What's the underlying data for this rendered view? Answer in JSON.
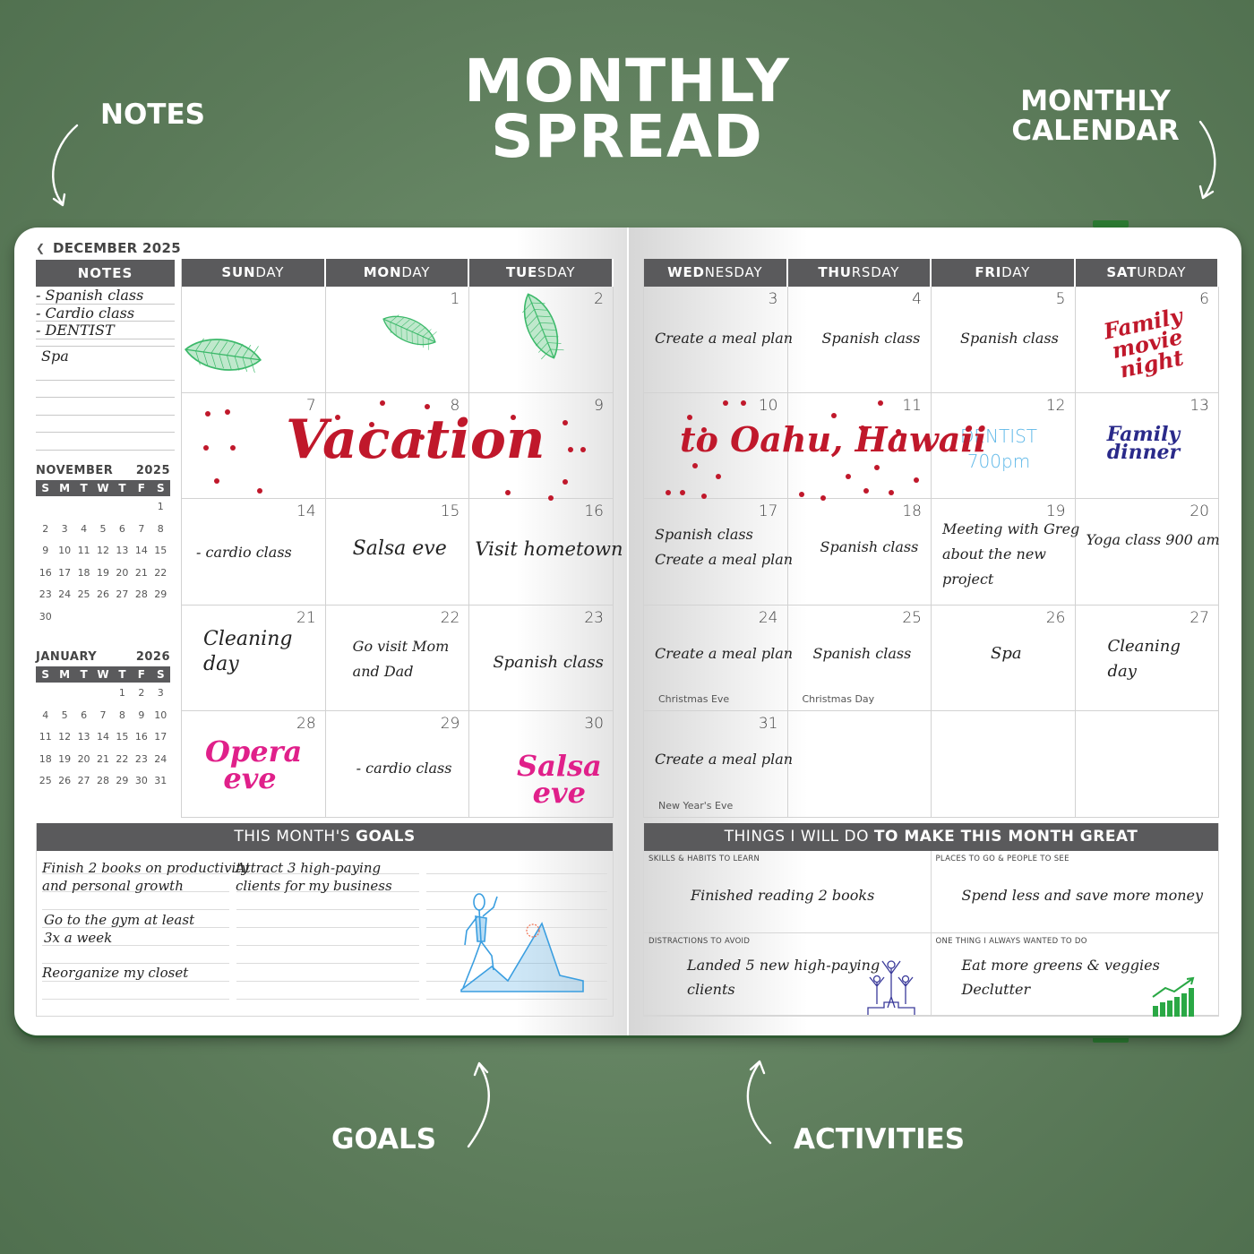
{
  "hero": {
    "title_line1": "MONTHLY",
    "title_line2": "SPREAD",
    "callouts": {
      "notes": "NOTES",
      "monthly_calendar_line1": "MONTHLY",
      "monthly_calendar_line2": "CALENDAR",
      "goals": "GOALS",
      "activities": "ACTIVITIES"
    }
  },
  "colors": {
    "background": "#6a8a68",
    "header_gray": "#5a5a5c",
    "vacation_red": "#c0182b",
    "dentist_blue": "#5fb8e8",
    "family_dinner_navy": "#2a2a8a",
    "pink": "#e0208a",
    "leaf_green": "#3cb96a"
  },
  "planner": {
    "month_title": "DECEMBER 2025",
    "notes": {
      "header": "NOTES",
      "lines": [
        "- Spanish class",
        "- Cardio class",
        "- DENTIST",
        "",
        "Spa",
        "",
        "",
        "",
        ""
      ]
    },
    "mini_calendars": [
      {
        "month": "NOVEMBER",
        "year": "2025",
        "weekdays": [
          "S",
          "M",
          "T",
          "W",
          "T",
          "F",
          "S"
        ],
        "days": [
          "",
          "",
          "",
          "",
          "",
          "",
          "1",
          "2",
          "3",
          "4",
          "5",
          "6",
          "7",
          "8",
          "9",
          "10",
          "11",
          "12",
          "13",
          "14",
          "15",
          "16",
          "17",
          "18",
          "19",
          "20",
          "21",
          "22",
          "23",
          "24",
          "25",
          "26",
          "27",
          "28",
          "29",
          "30"
        ]
      },
      {
        "month": "JANUARY",
        "year": "2026",
        "weekdays": [
          "S",
          "M",
          "T",
          "W",
          "T",
          "F",
          "S"
        ],
        "days": [
          "",
          "",
          "",
          "",
          "1",
          "2",
          "3",
          "4",
          "5",
          "6",
          "7",
          "8",
          "9",
          "10",
          "11",
          "12",
          "13",
          "14",
          "15",
          "16",
          "17",
          "18",
          "19",
          "20",
          "21",
          "22",
          "23",
          "24",
          "25",
          "26",
          "27",
          "28",
          "29",
          "30",
          "31"
        ]
      }
    ],
    "weekday_headers": [
      {
        "bold": "SUN",
        "rest": "DAY"
      },
      {
        "bold": "MON",
        "rest": "DAY"
      },
      {
        "bold": "TUE",
        "rest": "SDAY"
      },
      {
        "bold": "WED",
        "rest": "NESDAY"
      },
      {
        "bold": "THU",
        "rest": "RSDAY"
      },
      {
        "bold": "FRI",
        "rest": "DAY"
      },
      {
        "bold": "SAT",
        "rest": "URDAY"
      }
    ],
    "weeks": [
      [
        {
          "day": "",
          "notes": []
        },
        {
          "day": "1",
          "notes": []
        },
        {
          "day": "2",
          "notes": []
        },
        {
          "day": "3",
          "notes": [
            "Create a meal plan"
          ]
        },
        {
          "day": "4",
          "notes": [
            "Spanish class"
          ]
        },
        {
          "day": "5",
          "notes": [
            "Spanish class"
          ]
        },
        {
          "day": "6",
          "notes": [],
          "script": "Family movie night"
        }
      ],
      [
        {
          "day": "7",
          "notes": []
        },
        {
          "day": "8",
          "notes": []
        },
        {
          "day": "9",
          "notes": []
        },
        {
          "day": "10",
          "notes": []
        },
        {
          "day": "11",
          "notes": []
        },
        {
          "day": "12",
          "notes": [
            "DENTIST",
            "700pm"
          ]
        },
        {
          "day": "13",
          "notes": [],
          "script": "Family dinner"
        }
      ],
      [
        {
          "day": "14",
          "notes": [
            "- cardio class"
          ]
        },
        {
          "day": "15",
          "notes": [
            "Salsa eve"
          ]
        },
        {
          "day": "16",
          "notes": [
            "Visit hometown"
          ]
        },
        {
          "day": "17",
          "notes": [
            "Spanish class",
            "Create a meal plan"
          ]
        },
        {
          "day": "18",
          "notes": [
            "Spanish class"
          ]
        },
        {
          "day": "19",
          "notes": [
            "Meeting with Greg",
            "about the new",
            "project"
          ]
        },
        {
          "day": "20",
          "notes": [
            "Yoga class 900 am"
          ]
        }
      ],
      [
        {
          "day": "21",
          "notes": [
            "Cleaning",
            "day"
          ]
        },
        {
          "day": "22",
          "notes": [
            "Go visit Mom",
            "and Dad"
          ]
        },
        {
          "day": "23",
          "notes": [
            "Spanish class"
          ]
        },
        {
          "day": "24",
          "notes": [
            "Create a meal plan"
          ],
          "holiday": "Christmas Eve"
        },
        {
          "day": "25",
          "notes": [
            "Spanish class"
          ],
          "holiday": "Christmas Day"
        },
        {
          "day": "26",
          "notes": [
            "Spa"
          ]
        },
        {
          "day": "27",
          "notes": [
            "Cleaning",
            "day"
          ]
        }
      ],
      [
        {
          "day": "28",
          "notes": [],
          "script": "Opera eve"
        },
        {
          "day": "29",
          "notes": [
            "- cardio class"
          ]
        },
        {
          "day": "30",
          "notes": [],
          "script": "Salsa eve"
        },
        {
          "day": "31",
          "notes": [
            "Create a meal plan"
          ],
          "holiday": "New Year's Eve"
        },
        {
          "day": "",
          "notes": []
        },
        {
          "day": "",
          "notes": []
        },
        {
          "day": "",
          "notes": []
        }
      ]
    ],
    "banner_left": "Vacation",
    "banner_right": "to Oahu, Hawaii",
    "goals": {
      "header_light": "THIS MONTH'S ",
      "header_bold": "GOALS",
      "items": [
        [
          "Finish 2 books on productivity",
          "and personal growth"
        ],
        [
          "Attract 3 high-paying",
          "clients for my business"
        ],
        [
          "Go to the gym at least",
          "3x a week"
        ],
        [
          "Reorganize my closet"
        ]
      ]
    },
    "great": {
      "header_light": "THINGS I WILL DO ",
      "header_bold": "TO MAKE THIS MONTH GREAT",
      "cells": [
        {
          "label": "SKILLS & HABITS TO LEARN",
          "lines": [
            "Finished reading 2 books"
          ]
        },
        {
          "label": "PLACES TO GO & PEOPLE TO SEE",
          "lines": [
            "Spend less and save more money"
          ]
        },
        {
          "label": "DISTRACTIONS TO AVOID",
          "lines": [
            "Landed 5 new high-paying",
            "clients"
          ]
        },
        {
          "label": "ONE THING I ALWAYS WANTED TO DO",
          "lines": [
            "Eat more greens & veggies",
            "Declutter"
          ]
        }
      ]
    }
  }
}
